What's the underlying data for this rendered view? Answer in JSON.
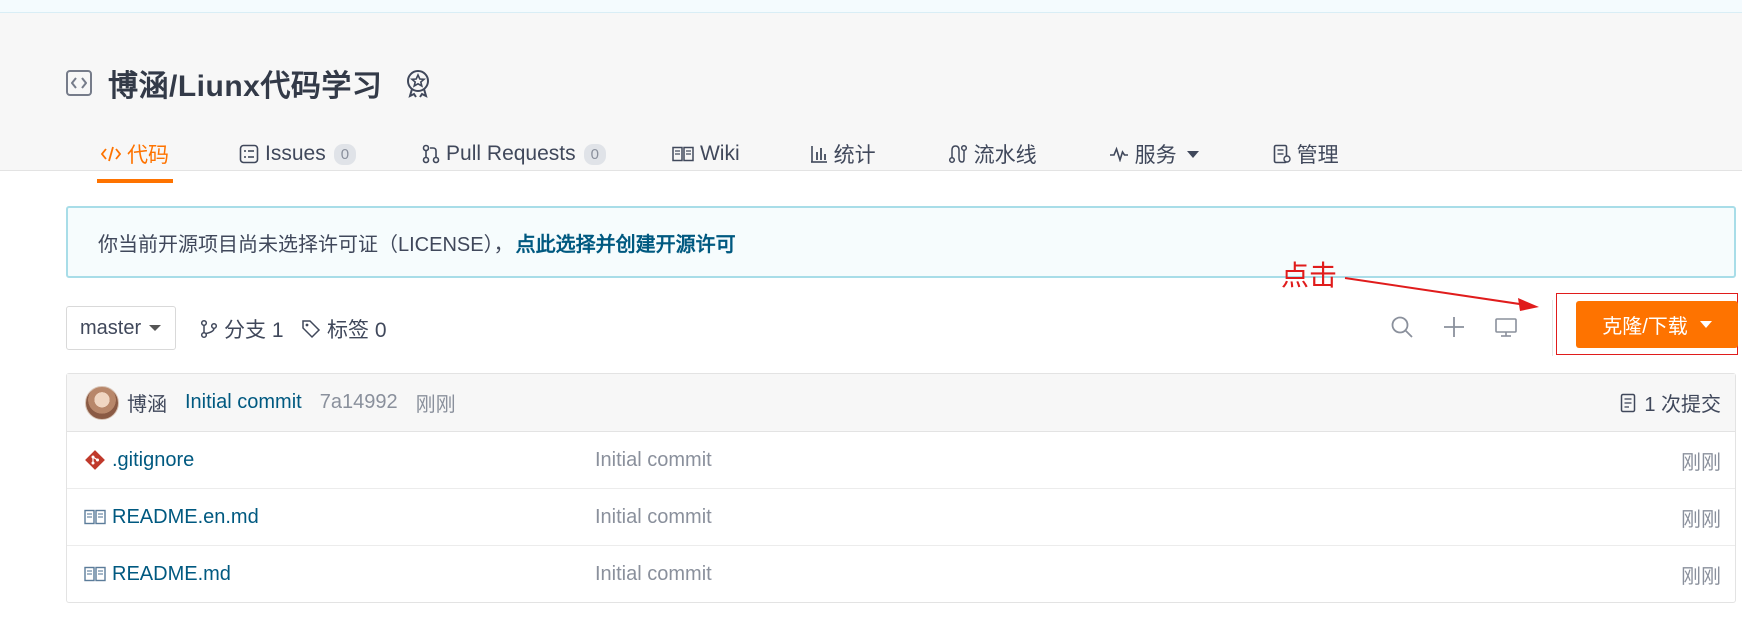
{
  "repo": {
    "title": "博涵/Liunx代码学习",
    "icons": {
      "repo": "code-bracket-icon",
      "badge": "award-badge-icon"
    }
  },
  "tabs": [
    {
      "label": "代码",
      "icon": "code-icon",
      "active": true
    },
    {
      "label": "Issues",
      "icon": "issues-icon",
      "count": "0"
    },
    {
      "label": "Pull Requests",
      "icon": "pull-request-icon",
      "count": "0"
    },
    {
      "label": "Wiki",
      "icon": "book-icon"
    },
    {
      "label": "统计",
      "icon": "bar-chart-icon"
    },
    {
      "label": "流水线",
      "icon": "pipeline-icon"
    },
    {
      "label": "服务",
      "icon": "pulse-icon",
      "dropdown": true
    },
    {
      "label": "管理",
      "icon": "settings-doc-icon"
    }
  ],
  "banner": {
    "text": "你当前开源项目尚未选择许可证（LICENSE），",
    "link": "点此选择并创建开源许可"
  },
  "annotation": {
    "text": "点击",
    "color": "#e01c1c"
  },
  "toolbar": {
    "branch": "master",
    "branches_label": "分支 1",
    "tags_label": "标签 0",
    "icons": [
      "search-icon",
      "plus-icon",
      "monitor-icon"
    ],
    "clone_label": "克隆/下载"
  },
  "commit": {
    "author": "博涵",
    "message": "Initial commit",
    "sha": "7a14992",
    "time": "刚刚",
    "count_label": "1 次提交"
  },
  "files": [
    {
      "name": ".gitignore",
      "icon": "git-file-icon",
      "commit": "Initial commit",
      "time": "刚刚"
    },
    {
      "name": "README.en.md",
      "icon": "book-icon",
      "commit": "Initial commit",
      "time": "刚刚"
    },
    {
      "name": "README.md",
      "icon": "book-icon",
      "commit": "Initial commit",
      "time": "刚刚"
    }
  ],
  "colors": {
    "accent": "#fe7300",
    "link": "#005980",
    "banner_border": "#a8dde8",
    "annotation": "#e01c1c"
  }
}
